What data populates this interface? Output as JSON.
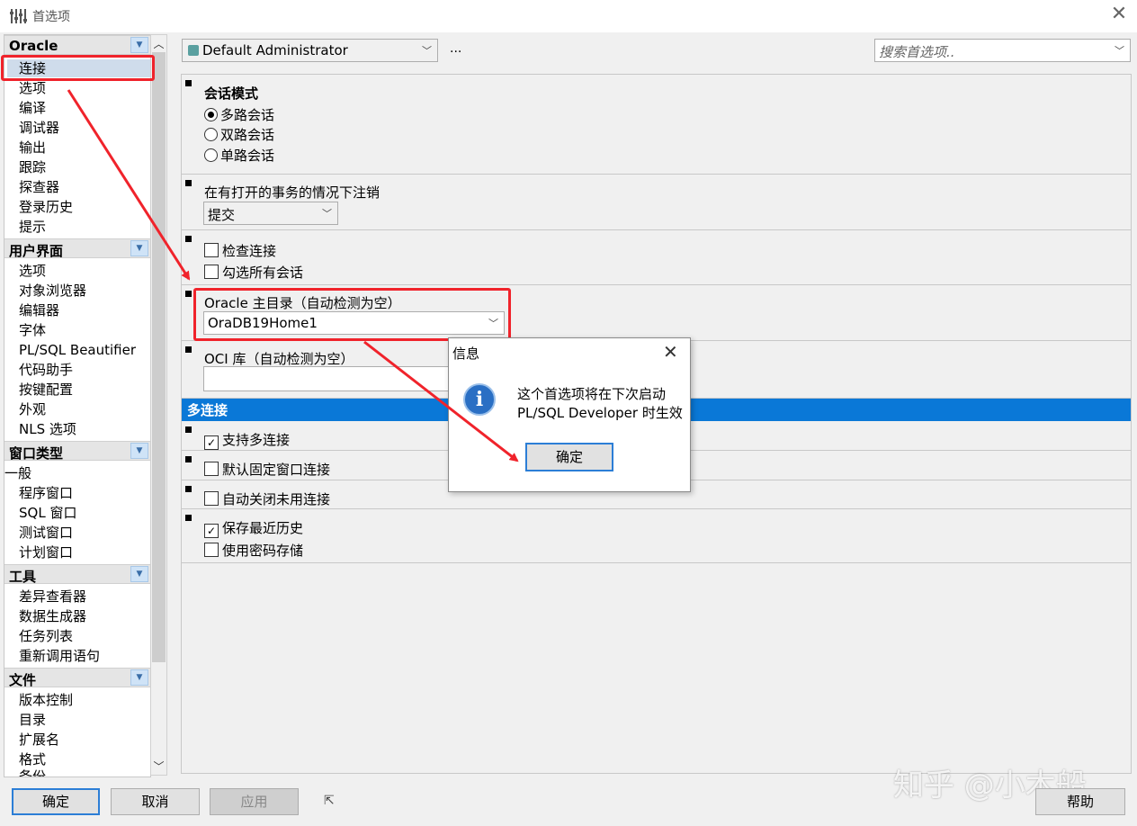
{
  "window": {
    "title": "首选项"
  },
  "sidebar": {
    "groups": [
      {
        "label": "Oracle",
        "items": [
          "连接",
          "选项",
          "编译",
          "调试器",
          "输出",
          "跟踪",
          "探查器",
          "登录历史",
          "提示"
        ]
      },
      {
        "label": "用户界面",
        "items": [
          "选项",
          "对象浏览器",
          "编辑器",
          "字体",
          "PL/SQL Beautifier",
          "代码助手",
          "按键配置",
          "外观",
          "NLS 选项"
        ]
      },
      {
        "label": "窗口类型",
        "items": [
          "一般",
          "程序窗口",
          "SQL 窗口",
          "测试窗口",
          "计划窗口"
        ]
      },
      {
        "label": "工具",
        "items": [
          "差异查看器",
          "数据生成器",
          "任务列表",
          "重新调用语句"
        ]
      },
      {
        "label": "文件",
        "items": [
          "版本控制",
          "目录",
          "扩展名",
          "格式",
          "备份"
        ]
      }
    ],
    "selected": "连接"
  },
  "topbar": {
    "profile": "Default Administrator",
    "more": "...",
    "search_placeholder": "搜索首选项.."
  },
  "sections": {
    "session_mode": {
      "title": "会话模式",
      "options": [
        "多路会话",
        "双路会话",
        "单路会话"
      ],
      "selected": "多路会话"
    },
    "logoff": {
      "title": "在有打开的事务的情况下注销",
      "value": "提交"
    },
    "checks": {
      "check_connection": "检查连接",
      "check_all_sessions": "勾选所有会话"
    },
    "oracle_home": {
      "title": "Oracle 主目录（自动检测为空）",
      "value": "OraDB19Home1"
    },
    "oci": {
      "title": "OCI 库（自动检测为空）",
      "value": ""
    },
    "multi": {
      "header": "多连接",
      "support_multi": "支持多连接",
      "default_fixed": "默认固定窗口连接",
      "auto_close": "自动关闭未用连接",
      "save_history": "保存最近历史",
      "use_password_store": "使用密码存储"
    }
  },
  "dialog": {
    "title": "信息",
    "line1": "这个首选项将在下次启动",
    "line2": "PL/SQL Developer 时生效",
    "ok": "确定",
    "icon": "info-icon"
  },
  "buttons": {
    "ok": "确定",
    "cancel": "取消",
    "apply": "应用",
    "help": "帮助"
  },
  "watermark": "知乎 @小木船",
  "colors": {
    "highlight": "#f0232b",
    "selection_bar": "#0a78d7"
  }
}
